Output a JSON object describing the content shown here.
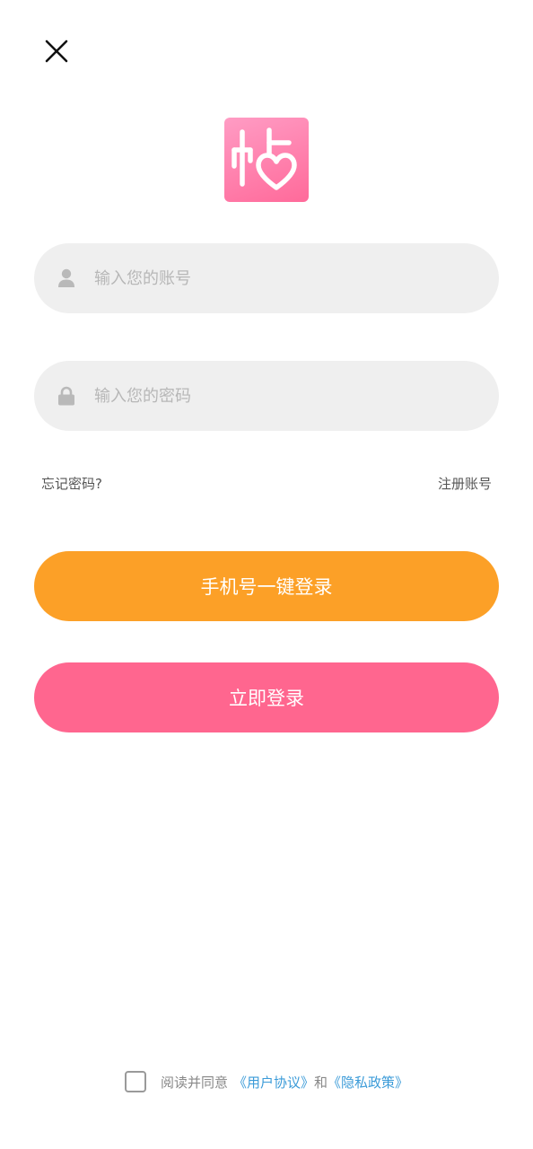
{
  "header": {
    "close_icon": "close-icon"
  },
  "logo": {
    "text": "帖",
    "colors": [
      "#ff9cc4",
      "#ff6a9a"
    ]
  },
  "form": {
    "account": {
      "placeholder": "输入您的账号",
      "value": "",
      "icon": "user-icon"
    },
    "password": {
      "placeholder": "输入您的密码",
      "value": "",
      "icon": "lock-icon"
    },
    "forgot_label": "忘记密码?",
    "register_label": "注册账号"
  },
  "buttons": {
    "phone_login_label": "手机号一键登录",
    "login_label": "立即登录"
  },
  "agreement": {
    "checked": false,
    "prefix": "阅读并同意",
    "user_agreement": "《用户协议》",
    "conjunction": "和",
    "privacy_policy": "《隐私政策》"
  },
  "colors": {
    "phone_button": "#fca027",
    "login_button": "#ff668f",
    "link": "#3b9bd8",
    "field_bg": "#efefef"
  }
}
